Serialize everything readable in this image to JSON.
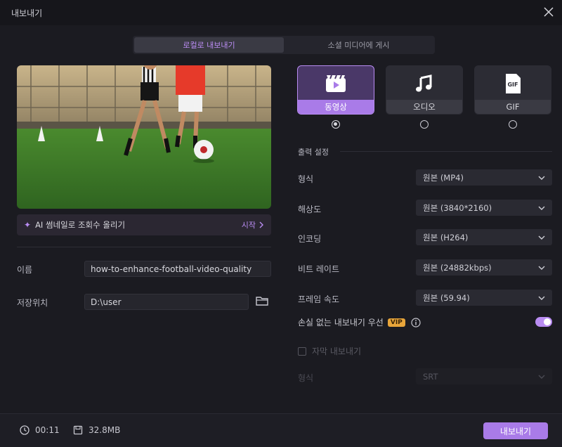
{
  "window": {
    "title": "내보내기"
  },
  "tabs": [
    {
      "label": "로컬로 내보내기",
      "active": true
    },
    {
      "label": "소셜 미디어에 게시",
      "active": false
    }
  ],
  "ai_bar": {
    "label": "AI 썸네일로 조회수 올리기",
    "action": "시작"
  },
  "fields": {
    "name_label": "이름",
    "name_value": "how-to-enhance-football-video-quality",
    "location_label": "저장위치",
    "location_value": "D:\\user"
  },
  "export_types": [
    {
      "label": "동영상",
      "icon": "video-icon",
      "selected": true
    },
    {
      "label": "오디오",
      "icon": "music-icon",
      "selected": false
    },
    {
      "label": "GIF",
      "icon": "gif-icon",
      "selected": false
    }
  ],
  "output": {
    "section_title": "출력 설정",
    "settings": [
      {
        "label": "형식",
        "value": "원본 (MP4)"
      },
      {
        "label": "해상도",
        "value": "원본 (3840*2160)"
      },
      {
        "label": "인코딩",
        "value": "원본 (H264)"
      },
      {
        "label": "비트 레이트",
        "value": "원본 (24882kbps)"
      },
      {
        "label": "프레임 속도",
        "value": "원본 (59.94)"
      }
    ],
    "lossless_label": "손실 없는 내보내기 우선",
    "vip_badge": "VIP",
    "lossless_enabled": true,
    "subtitle_label": "자막 내보내기",
    "subtitle_format_label": "형식",
    "subtitle_format_value": "SRT"
  },
  "footer": {
    "duration": "00:11",
    "size": "32.8MB",
    "export_label": "내보내기"
  },
  "colors": {
    "accent": "#a97be8",
    "vip": "#e8a53a",
    "background": "#1b1b21"
  }
}
